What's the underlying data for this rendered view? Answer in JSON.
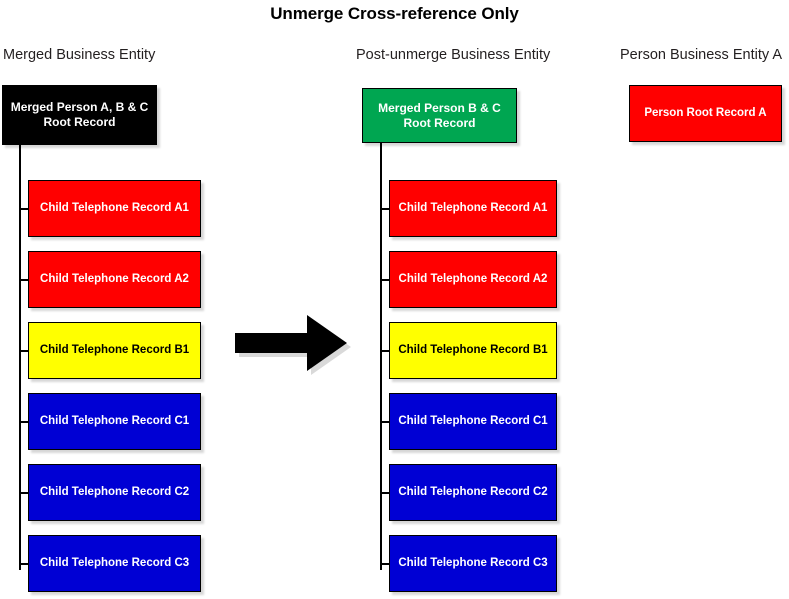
{
  "title": "Unmerge Cross-reference Only",
  "colors": {
    "black": "#000000",
    "green": "#00a651",
    "red": "#ff0000",
    "yellow": "#ffff00",
    "blue": "#0000d4",
    "text_light": "#ffffff",
    "text_dark": "#000000",
    "arrow": "#000000"
  },
  "columns": [
    {
      "header": "Merged Business Entity",
      "root": {
        "label": "Merged Person A, B & C\nRoot Record",
        "color": "black"
      },
      "children": [
        {
          "label": "Child Telephone Record A1",
          "color": "red"
        },
        {
          "label": "Child Telephone Record A2",
          "color": "red"
        },
        {
          "label": "Child Telephone Record B1",
          "color": "yellow"
        },
        {
          "label": "Child Telephone Record C1",
          "color": "blue"
        },
        {
          "label": "Child Telephone Record C2",
          "color": "blue"
        },
        {
          "label": "Child Telephone Record C3",
          "color": "blue"
        }
      ]
    },
    {
      "header": "Post-unmerge Business Entity",
      "root": {
        "label": "Merged Person B & C\nRoot Record",
        "color": "green"
      },
      "children": [
        {
          "label": "Child Telephone Record A1",
          "color": "red"
        },
        {
          "label": "Child Telephone Record A2",
          "color": "red"
        },
        {
          "label": "Child Telephone Record B1",
          "color": "yellow"
        },
        {
          "label": "Child Telephone Record C1",
          "color": "blue"
        },
        {
          "label": "Child Telephone Record C2",
          "color": "blue"
        },
        {
          "label": "Child Telephone Record C3",
          "color": "blue"
        }
      ]
    },
    {
      "header": "Person Business Entity A",
      "root": {
        "label": "Person Root Record A",
        "color": "red"
      },
      "children": []
    }
  ],
  "arrow": {
    "name": "right-arrow",
    "direction": "right"
  }
}
